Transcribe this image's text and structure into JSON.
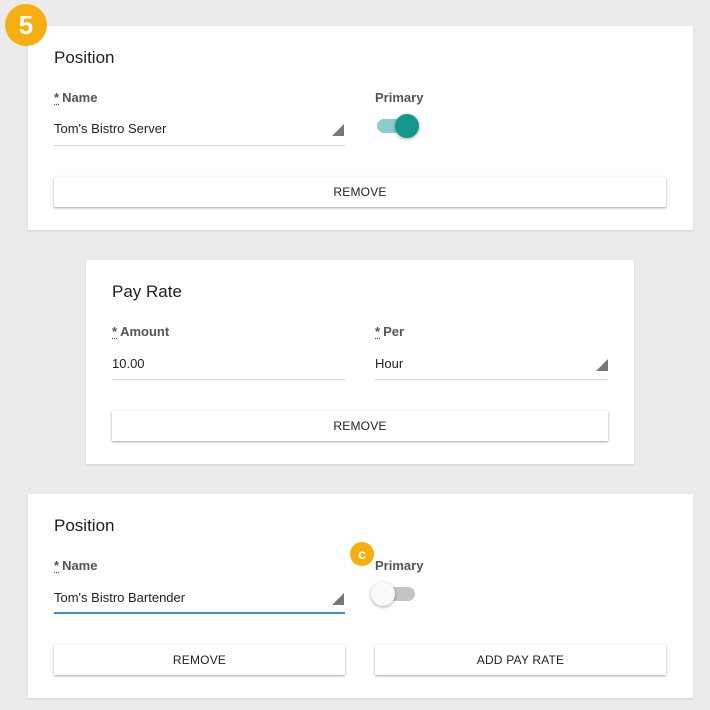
{
  "step_badge": "5",
  "annotation_badge": "c",
  "colors": {
    "accent_teal": "#13978a",
    "badge_orange": "#f6ae13",
    "focus_blue": "#3a8fd6"
  },
  "required_marker": "*",
  "position_card_1": {
    "title": "Position",
    "name_label": "Name",
    "name_value": "Tom's Bistro Server",
    "primary_label": "Primary",
    "primary_on": true,
    "remove_label": "REMOVE"
  },
  "pay_rate_card": {
    "title": "Pay Rate",
    "amount_label": "Amount",
    "amount_value": "10.00",
    "per_label": "Per",
    "per_value": "Hour",
    "remove_label": "REMOVE"
  },
  "position_card_2": {
    "title": "Position",
    "name_label": "Name",
    "name_value": "Tom's Bistro Bartender",
    "primary_label": "Primary",
    "primary_on": false,
    "remove_label": "REMOVE",
    "add_pay_rate_label": "ADD PAY RATE"
  }
}
